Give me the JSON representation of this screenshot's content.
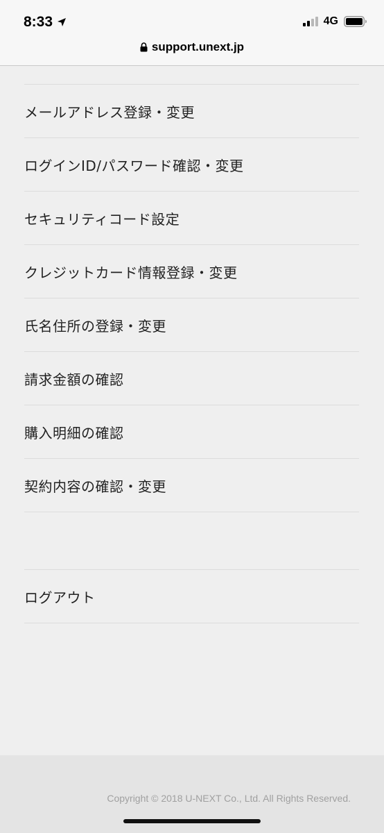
{
  "status_bar": {
    "time": "8:33",
    "network": "4G"
  },
  "url_bar": {
    "domain": "support.unext.jp"
  },
  "menu": {
    "items": [
      {
        "label": "メールアドレス登録・変更"
      },
      {
        "label": "ログインID/パスワード確認・変更"
      },
      {
        "label": "セキュリティコード設定"
      },
      {
        "label": "クレジットカード情報登録・変更"
      },
      {
        "label": "氏名住所の登録・変更"
      },
      {
        "label": "請求金額の確認"
      },
      {
        "label": "購入明細の確認"
      },
      {
        "label": "契約内容の確認・変更"
      }
    ],
    "logout_label": "ログアウト"
  },
  "footer": {
    "copyright": "Copyright © 2018 U-NEXT Co., Ltd. All Rights Reserved."
  }
}
